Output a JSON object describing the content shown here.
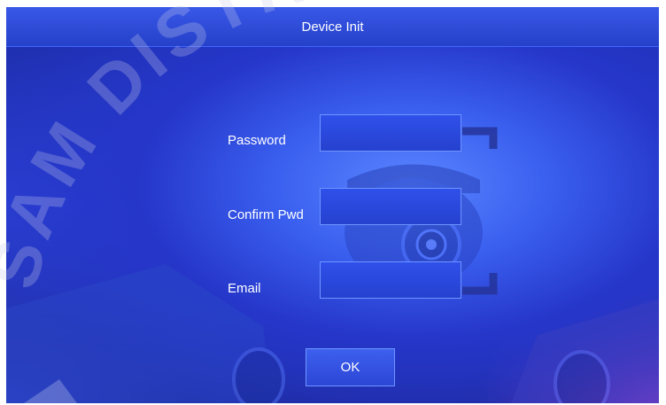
{
  "window": {
    "title": "Device Init"
  },
  "form": {
    "password_label": "Password",
    "password_value": "",
    "confirm_label": "Confirm Pwd",
    "confirm_value": "",
    "email_label": "Email",
    "email_value": ""
  },
  "actions": {
    "ok_label": "OK"
  },
  "watermark": {
    "text": "SAM DISTRIBU",
    "color": "#c8cbe8"
  },
  "colors": {
    "background": "#2a3fd2",
    "input_border": "#6f95ff",
    "text": "#ffffff"
  }
}
